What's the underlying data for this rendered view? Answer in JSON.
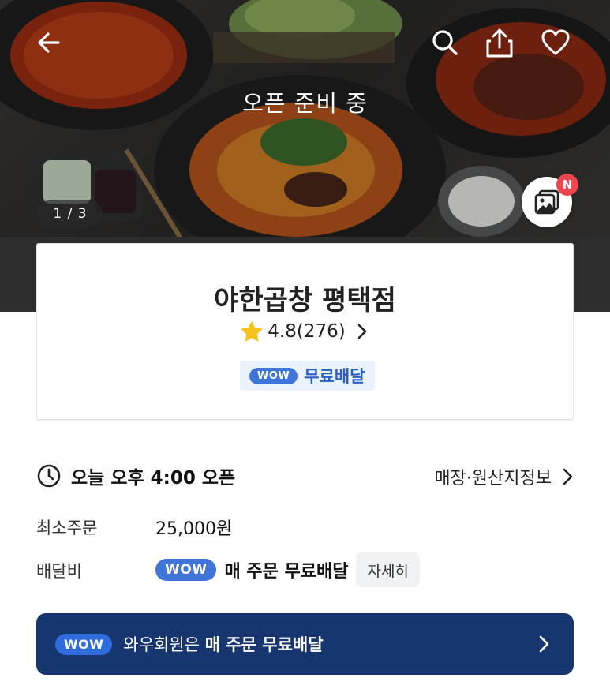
{
  "hero": {
    "status": "오픈 준비 중",
    "counter": "1 / 3",
    "new_badge": "N",
    "icons": [
      "back-arrow-icon",
      "search-icon",
      "share-icon",
      "heart-icon",
      "photo-gallery-icon"
    ]
  },
  "store": {
    "name": "야한곱창 평택점",
    "rating": "4.8",
    "review_count": "(276)",
    "wow_label": "WOW",
    "free_delivery": "무료배달"
  },
  "info": {
    "open_time": "오늘 오후 4:00 오픈",
    "origin_link": "매장·원산지정보",
    "min_order_label": "최소주문",
    "min_order_value": "25,000원",
    "delivery_fee_label": "배달비",
    "delivery_fee_wow": "WOW",
    "delivery_fee_text": "매 주문 무료배달",
    "detail_button": "자세히"
  },
  "banner": {
    "wow": "WOW",
    "text_prefix": "와우회원은 ",
    "text_strong": "매 주문 무료배달"
  },
  "colors": {
    "accent_blue": "#3f74d9",
    "banner_navy": "#173670",
    "badge_red": "#f0454f",
    "star_yellow": "#f6c21c"
  }
}
